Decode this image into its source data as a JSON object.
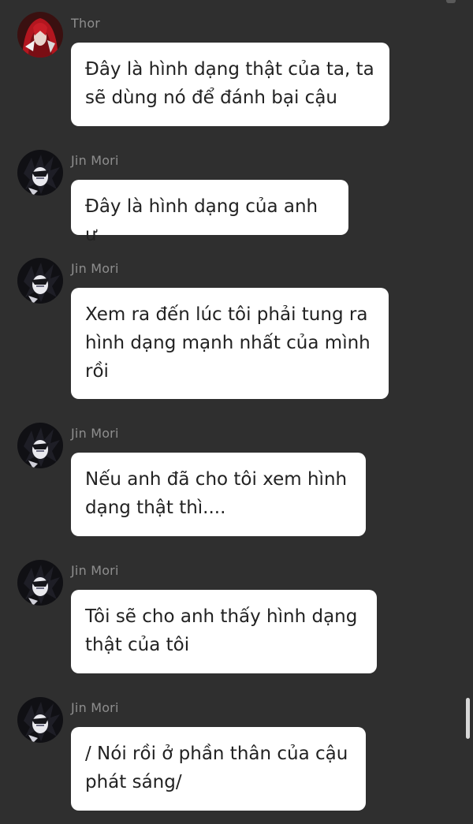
{
  "messages": [
    {
      "sender": "Thor",
      "avatar": "thor-avatar-icon",
      "text": "Đây là hình dạng thật của ta, ta\nsẽ dùng nó để đánh bại cậu"
    },
    {
      "sender": "Jin Mori",
      "avatar": "jin-mori-avatar-icon",
      "text": "Đây là hình dạng của anh ư"
    },
    {
      "sender": "Jin Mori",
      "avatar": "jin-mori-avatar-icon",
      "text": "Xem ra đến lúc tôi phải tung ra\nhình dạng mạnh nhất của mình\nrồi"
    },
    {
      "sender": "Jin Mori",
      "avatar": "jin-mori-avatar-icon",
      "text": "Nếu anh đã cho tôi xem hình\ndạng thật thì...."
    },
    {
      "sender": "Jin Mori",
      "avatar": "jin-mori-avatar-icon",
      "text": "Tôi sẽ cho anh thấy hình dạng\nthật của tôi"
    },
    {
      "sender": "Jin Mori",
      "avatar": "jin-mori-avatar-icon",
      "text": "/ Nói rồi ở phần thân của cậu\nphát sáng/"
    }
  ],
  "colors": {
    "background": "#2f2f2f",
    "bubble": "#ffffff",
    "sender_text": "#8e8e8e",
    "message_text": "#222222",
    "thor_accent": "#c0202a"
  }
}
